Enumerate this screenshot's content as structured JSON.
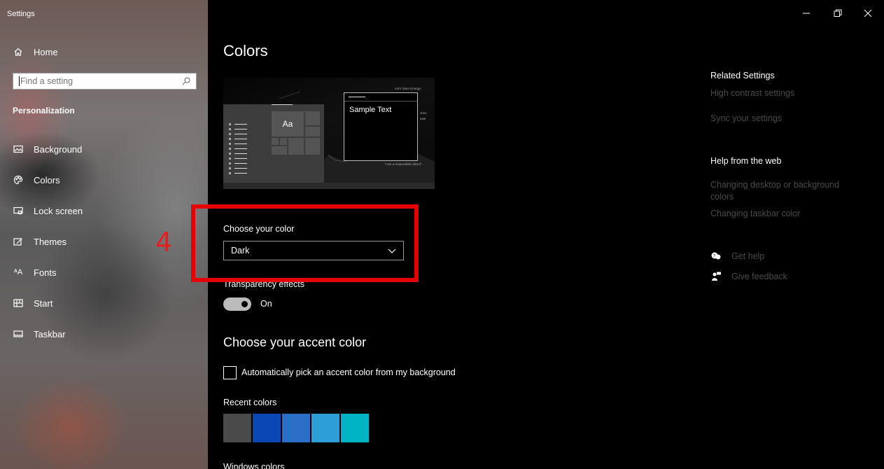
{
  "window": {
    "title": "Settings"
  },
  "sidebar": {
    "home_label": "Home",
    "search_placeholder": "Find a setting",
    "section": "Personalization",
    "items": [
      {
        "label": "Background",
        "icon": "image-icon"
      },
      {
        "label": "Colors",
        "icon": "palette-icon"
      },
      {
        "label": "Lock screen",
        "icon": "lock-screen-icon"
      },
      {
        "label": "Themes",
        "icon": "brush-icon"
      },
      {
        "label": "Fonts",
        "icon": "fonts-icon"
      },
      {
        "label": "Start",
        "icon": "start-icon"
      },
      {
        "label": "Taskbar",
        "icon": "taskbar-icon"
      }
    ]
  },
  "main": {
    "title": "Colors",
    "preview": {
      "sample_text": "Sample Text",
      "tile_text": "Aa",
      "caption_top": "Let's Save Energy!",
      "caption_side_1": "vhen",
      "caption_side_2": "east",
      "caption_bottom": "\"I am a responsible citizen\""
    },
    "choose_color_label": "Choose your color",
    "choose_color_value": "Dark",
    "transparency_label": "Transparency effects",
    "transparency_state": "On",
    "accent_heading": "Choose your accent color",
    "auto_accent_label": "Automatically pick an accent color from my background",
    "recent_colors_label": "Recent colors",
    "recent_colors": [
      "#4a4a4a",
      "#0a47b5",
      "#2a6ec6",
      "#2e9ed6",
      "#00b4c4"
    ],
    "windows_colors_label": "Windows colors"
  },
  "annotation": {
    "number": "4",
    "color": "#e60000"
  },
  "related": {
    "title": "Related Settings",
    "links": [
      "High contrast settings",
      "Sync your settings"
    ],
    "help_title": "Help from the web",
    "help_links": [
      "Changing desktop or background colors",
      "Changing taskbar color"
    ],
    "get_help": "Get help",
    "give_feedback": "Give feedback"
  }
}
